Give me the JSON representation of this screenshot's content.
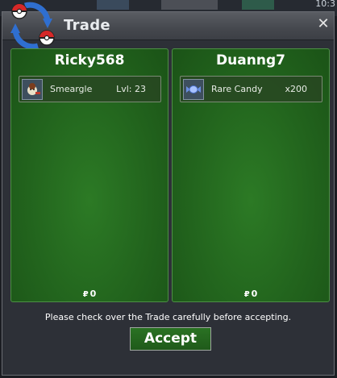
{
  "window": {
    "title": "Trade",
    "close_label": "✕"
  },
  "top_bar": {
    "clock": "10:3"
  },
  "left_offer": {
    "player_name": "Ricky568",
    "items": [
      {
        "name": "Smeargle",
        "detail": "Lvl: 23",
        "icon": "smeargle-pokemon-icon"
      }
    ],
    "money_symbol": "₽",
    "money": "0"
  },
  "right_offer": {
    "player_name": "Duanng7",
    "items": [
      {
        "name": "Rare Candy",
        "detail": "x200",
        "icon": "rare-candy-icon"
      }
    ],
    "money_symbol": "₽",
    "money": "0"
  },
  "footer": {
    "note": "Please check over the Trade carefully before accepting.",
    "accept_label": "Accept"
  },
  "colors": {
    "panel_green": "#22641d",
    "accept_green": "#2a7223",
    "window_bg": "#2d3037"
  }
}
